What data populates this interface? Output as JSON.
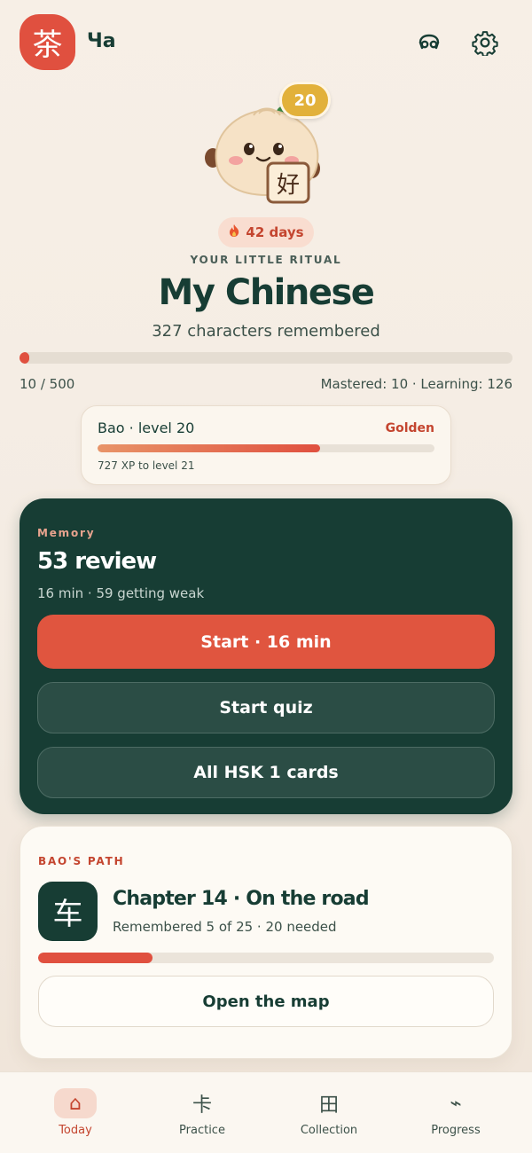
{
  "header": {
    "logo_char": "茶",
    "app_name": "Ча",
    "icons": [
      "face-icon",
      "gear-icon"
    ]
  },
  "mascot": {
    "level_badge": "20",
    "sign_char": "好"
  },
  "streak": {
    "icon": "fire-icon",
    "label": "42 days"
  },
  "hero": {
    "overline": "YOUR LITTLE RITUAL",
    "title": "My Chinese",
    "subtitle": "327 characters remembered"
  },
  "progress": {
    "label_left": "10 / 500",
    "label_right": "Mastered: 10 · Learning: 126",
    "fraction": 0.02
  },
  "bao_card": {
    "title": "Bao · level 20",
    "tier": "Golden",
    "xp_text": "727 XP to level 21",
    "fraction": 0.66
  },
  "memory": {
    "overline": "Memory",
    "title": "53 review",
    "subtitle": "16 min · 59 getting weak",
    "primary_button": "Start · 16 min",
    "quiz_button": "Start quiz",
    "cards_button": "All HSK 1 cards"
  },
  "path": {
    "overline": "BAO'S PATH",
    "chapter_char": "车",
    "chapter_title": "Chapter 14 · On the road",
    "chapter_sub": "Remembered 5 of 25 · 20 needed",
    "fraction": 0.25,
    "map_button": "Open the map"
  },
  "nav": {
    "items": [
      {
        "label": "Today",
        "icon": "⌂",
        "active": true
      },
      {
        "label": "Practice",
        "icon": "卡",
        "active": false
      },
      {
        "label": "Collection",
        "icon": "田",
        "active": false
      },
      {
        "label": "Progress",
        "icon": "⌁",
        "active": false
      }
    ]
  },
  "colors": {
    "accent": "#e0503f",
    "dark_green": "#173d34",
    "gold": "#e2b13a",
    "background": "#f5ede4"
  }
}
